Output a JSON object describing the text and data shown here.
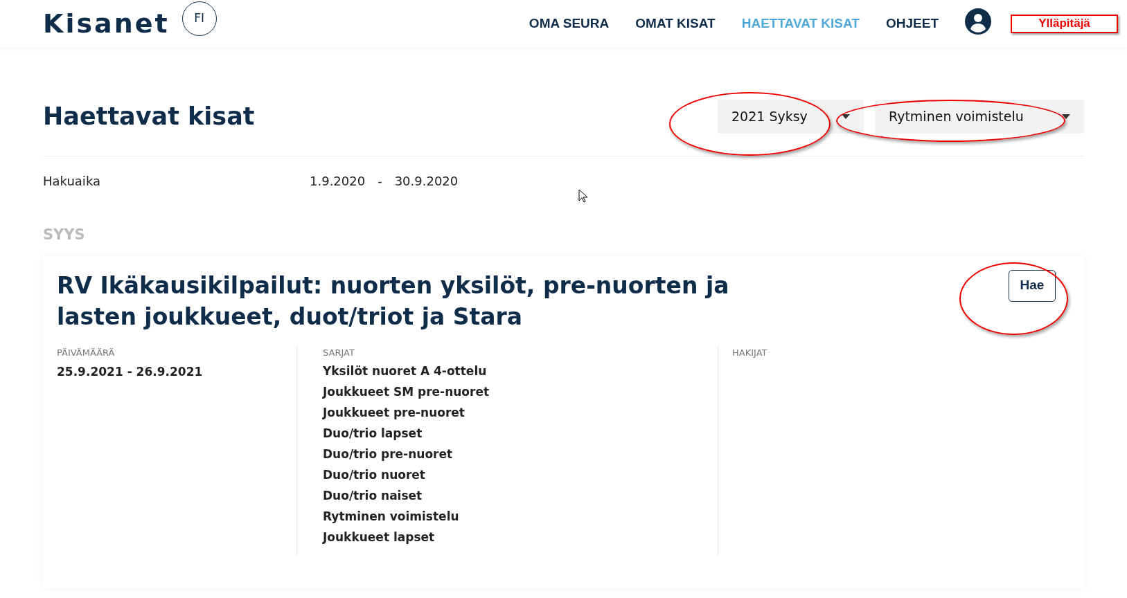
{
  "header": {
    "logo": "Kisanet",
    "language": "FI",
    "nav": [
      {
        "label": "OMA SEURA",
        "selected": false
      },
      {
        "label": "OMAT KISAT",
        "selected": false
      },
      {
        "label": "HAETTAVAT KISAT",
        "selected": true
      },
      {
        "label": "OHJEET",
        "selected": false
      }
    ],
    "role": "Ylläpitäjä"
  },
  "page": {
    "title": "Haettavat kisat",
    "filters": [
      {
        "value": "2021 Syksy"
      },
      {
        "value": "Rytminen voimistelu"
      }
    ],
    "period": {
      "label": "Hakuaika",
      "start": "1.9.2020",
      "separator": "-",
      "end": "30.9.2020"
    }
  },
  "section": {
    "heading": "SYYS",
    "competition": {
      "title": "RV Ikäkausikilpailut: nuorten yksilöt, pre-nuorten ja lasten joukkueet, duot/triot ja Stara",
      "apply_button": "Hae",
      "date": {
        "label": "PÄIVÄMÄÄRÄ",
        "value": "25.9.2021 - 26.9.2021"
      },
      "series": {
        "label": "SARJAT",
        "items": [
          "Yksilöt nuoret A 4-ottelu",
          "Joukkueet SM pre-nuoret",
          "Joukkueet pre-nuoret",
          "Duo/trio lapset",
          "Duo/trio pre-nuoret",
          "Duo/trio nuoret",
          "Duo/trio naiset",
          "Rytminen voimistelu",
          "Joukkueet lapset"
        ]
      },
      "applicants": {
        "label": "HAKIJAT"
      }
    }
  }
}
